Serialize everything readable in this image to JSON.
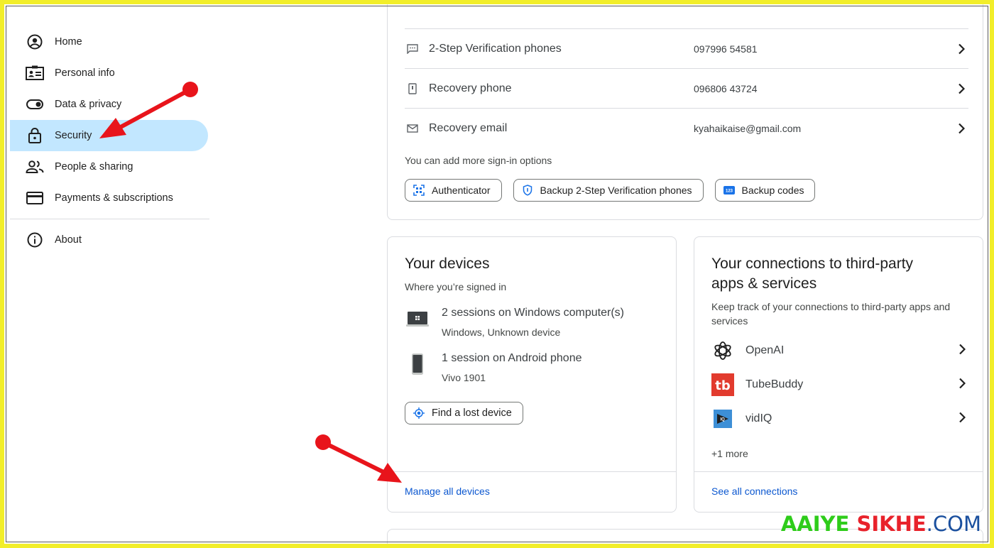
{
  "sidebar": {
    "items": [
      {
        "label": "Home",
        "icon": "account-circle-icon"
      },
      {
        "label": "Personal info",
        "icon": "id-card-icon"
      },
      {
        "label": "Data & privacy",
        "icon": "toggle-icon"
      },
      {
        "label": "Security",
        "icon": "lock-icon",
        "active": true
      },
      {
        "label": "People & sharing",
        "icon": "people-icon"
      },
      {
        "label": "Payments & subscriptions",
        "icon": "credit-card-icon"
      }
    ],
    "about": {
      "label": "About",
      "icon": "info-icon"
    }
  },
  "signin": {
    "rows": [
      {
        "label": "2-Step Verification phones",
        "value": "097996 54581",
        "icon": "sms-icon"
      },
      {
        "label": "Recovery phone",
        "value": "096806 43724",
        "icon": "phone-icon"
      },
      {
        "label": "Recovery email",
        "value": "kyahaikaise@gmail.com",
        "icon": "mail-icon"
      }
    ],
    "hint": "You can add more sign-in options",
    "chips": [
      {
        "label": "Authenticator",
        "icon": "qr-scan-icon"
      },
      {
        "label": "Backup 2-Step Verification phones",
        "icon": "shield-icon"
      },
      {
        "label": "Backup codes",
        "icon": "codes-123-icon"
      }
    ]
  },
  "devices": {
    "title": "Your devices",
    "subtitle": "Where you’re signed in",
    "items": [
      {
        "title": "2 sessions on Windows computer(s)",
        "sub": "Windows, Unknown device",
        "icon": "laptop-icon"
      },
      {
        "title": "1 session on Android phone",
        "sub": "Vivo 1901",
        "icon": "android-phone-icon"
      }
    ],
    "find_button": "Find a lost device",
    "footer_link": "Manage all devices"
  },
  "connections": {
    "title_line1": "Your connections to third-party",
    "title_line2": "apps & services",
    "subtitle_line1": "Keep track of your connections to third-party apps and",
    "subtitle_line2": "services",
    "apps": [
      {
        "name": "OpenAI",
        "icon": "openai-logo-icon"
      },
      {
        "name": "TubeBuddy",
        "icon": "tubebuddy-logo-icon",
        "color": "#e23b2e"
      },
      {
        "name": "vidIQ",
        "icon": "vidiq-logo-icon",
        "color": "#3d8fd6"
      }
    ],
    "more": "+1 more",
    "footer_link": "See all connections"
  },
  "watermark": {
    "part1": "AAIYE ",
    "part2": "SIKHE",
    "part3": ".COM"
  },
  "colors": {
    "active_bg": "#c2e7ff",
    "link": "#0b57d0",
    "frame": "#f2ee2a",
    "arrow": "#e8141b"
  }
}
